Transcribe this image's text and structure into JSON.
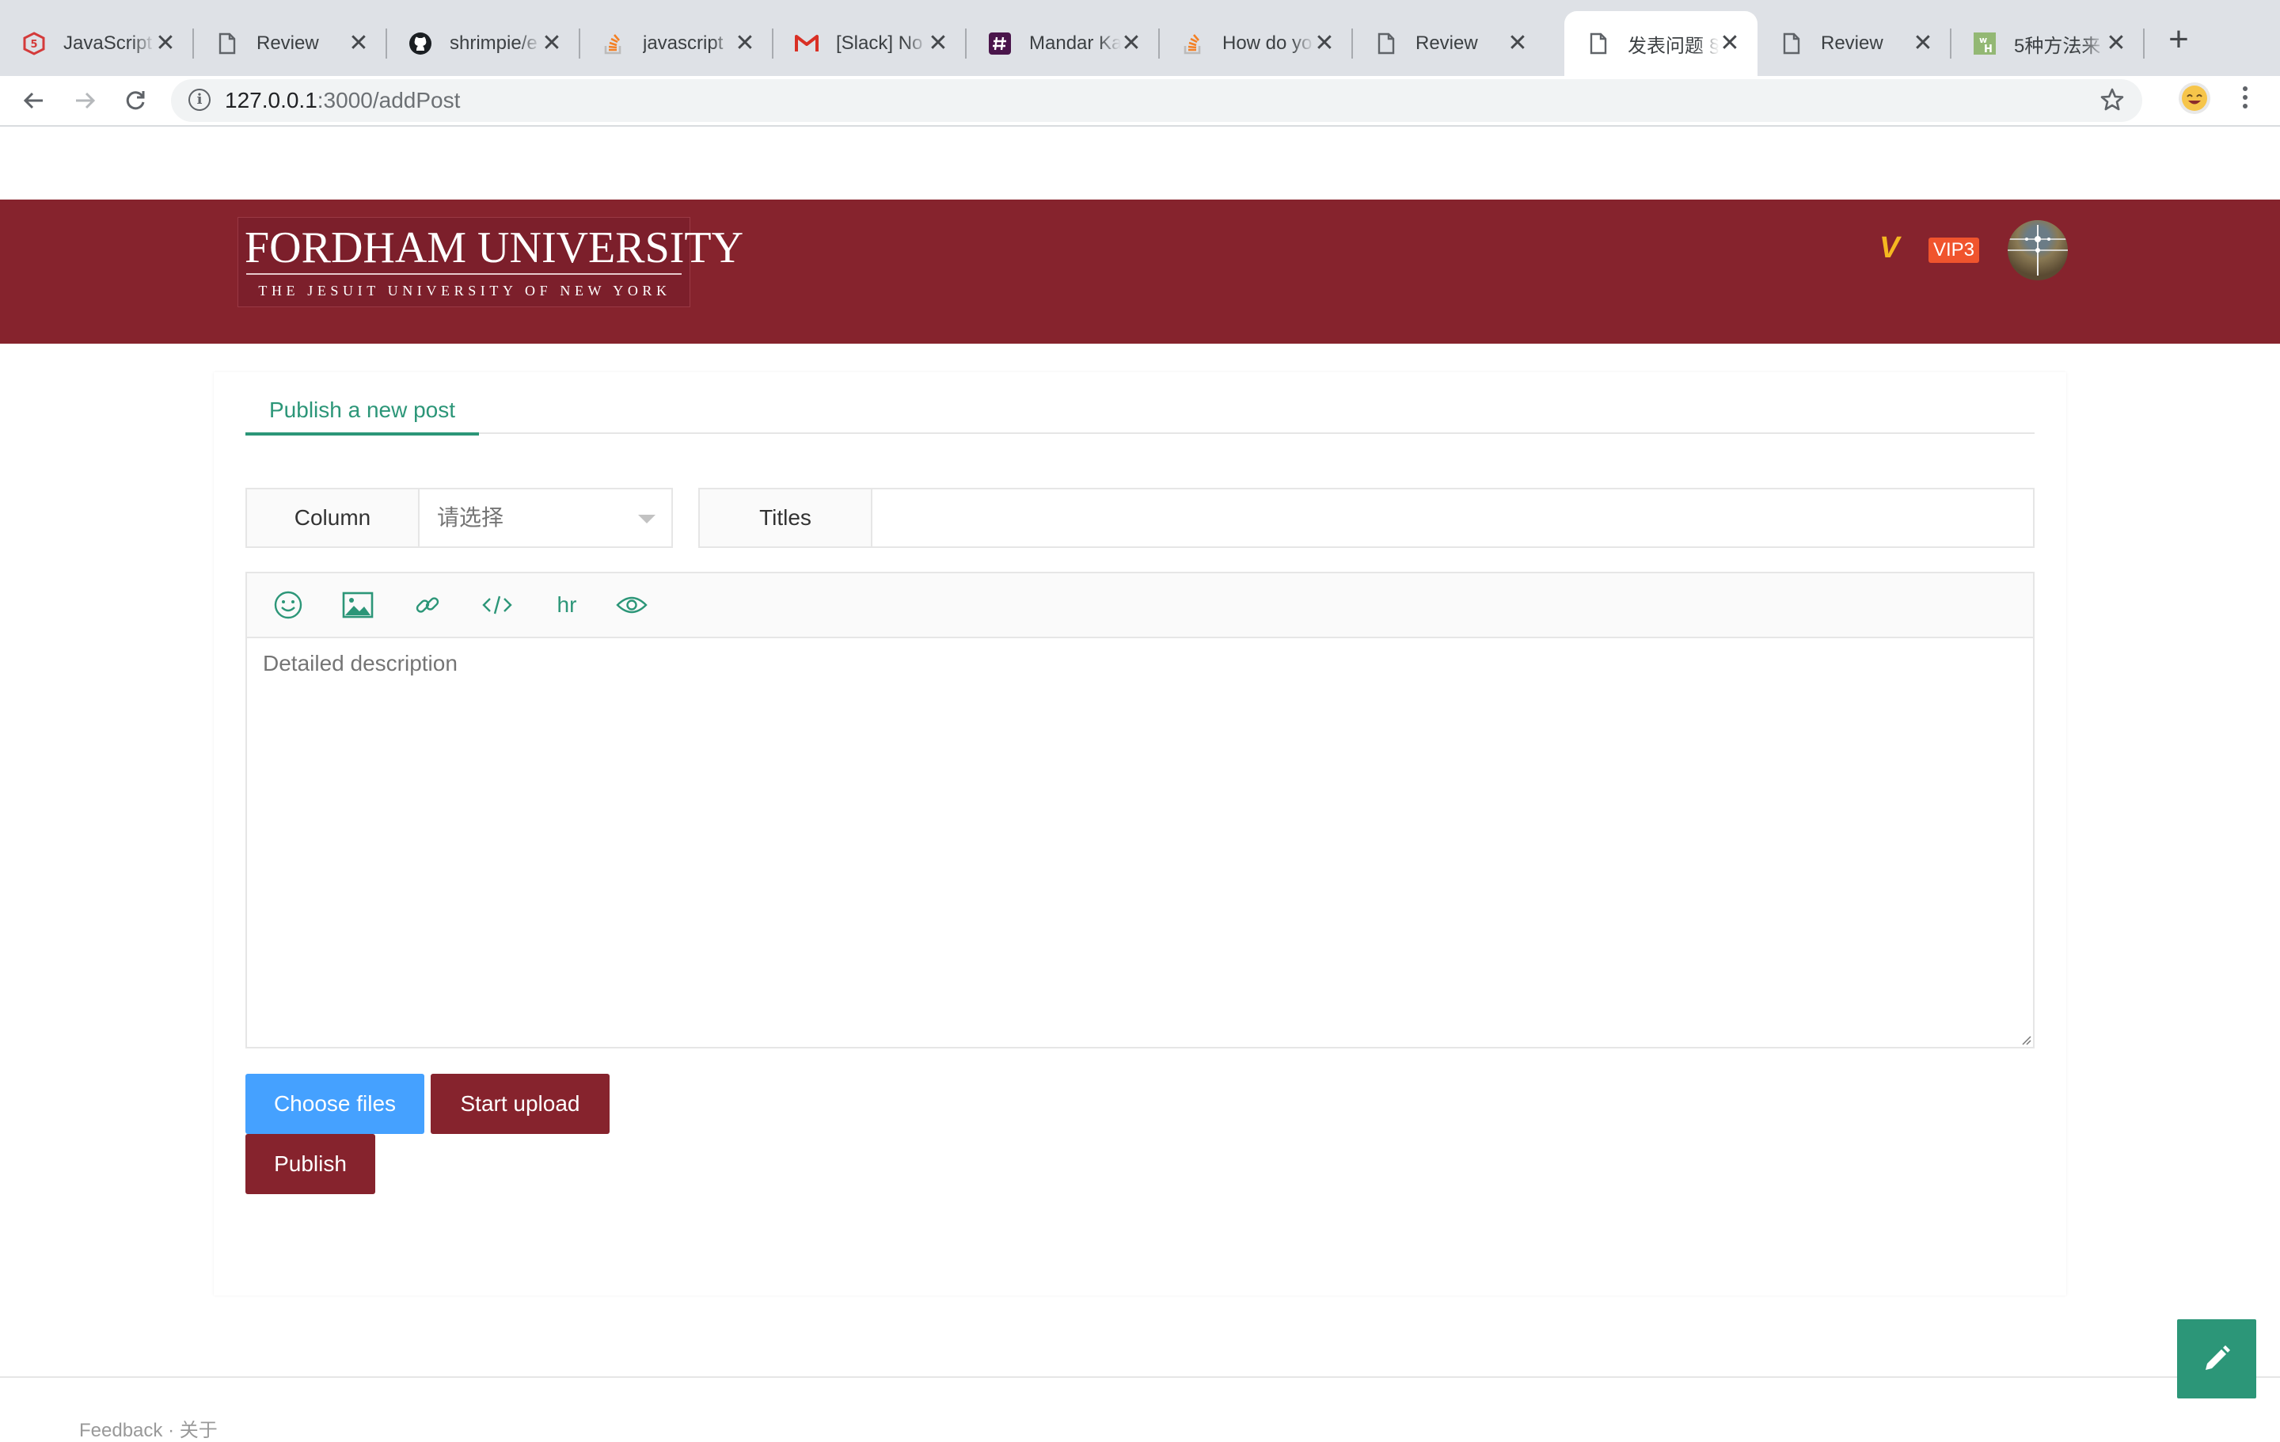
{
  "browser": {
    "tabs": [
      {
        "title": "JavaScript",
        "icon": "javascript-site-icon"
      },
      {
        "title": "Review",
        "icon": "page-icon"
      },
      {
        "title": "shrimpie/e",
        "icon": "github-icon"
      },
      {
        "title": "javascript",
        "icon": "stackoverflow-icon"
      },
      {
        "title": "[Slack] No",
        "icon": "gmail-icon"
      },
      {
        "title": "Mandar Ka",
        "icon": "slack-hash-icon"
      },
      {
        "title": "How do yo",
        "icon": "stackoverflow-icon"
      },
      {
        "title": "Review",
        "icon": "page-icon"
      },
      {
        "title": "发表问题 §",
        "icon": "page-icon"
      },
      {
        "title": "Review",
        "icon": "page-icon"
      },
      {
        "title": "5种方法来",
        "icon": "wikihow-icon"
      }
    ],
    "active_tab_index": 8,
    "close_glyph": "✕",
    "new_tab_glyph": "+",
    "url_host": "127.0.0.1",
    "url_rest": ":3000/addPost"
  },
  "header": {
    "logo_main": "FORDHAM UNIVERSITY",
    "logo_sub": "THE JESUIT UNIVERSITY OF NEW YORK",
    "vip_icon": "V",
    "vip_badge": "VIP3",
    "colors": {
      "header_bg": "#86232d",
      "vip_yellow": "#f5b820",
      "vip_orange": "#f0542d"
    }
  },
  "form": {
    "tab_label": "Publish a new post",
    "column_label": "Column",
    "column_select_value": "请选择",
    "titles_label": "Titles",
    "titles_value": "",
    "toolbar": {
      "emoji": "smiley-icon",
      "image": "image-icon",
      "link": "link-icon",
      "code": "code-icon",
      "hr_label": "hr",
      "preview": "eye-icon"
    },
    "description_placeholder": "Detailed description",
    "choose_files_label": "Choose files",
    "start_upload_label": "Start upload",
    "publish_label": "Publish",
    "colors": {
      "accent_green": "#2c9678",
      "blue_button": "#45a1ff",
      "red_button": "#86232d"
    }
  },
  "footer": {
    "text": "Feedback · 关于"
  }
}
